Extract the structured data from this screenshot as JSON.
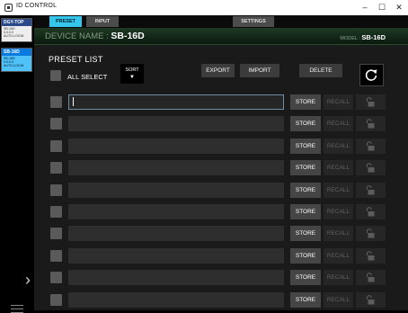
{
  "window": {
    "title": "ID CONTROL",
    "minimize_glyph": "–",
    "maximize_glyph": "☐",
    "close_glyph": "✕"
  },
  "sidebar": {
    "devices": [
      {
        "name": "DGY-TOP",
        "model": "SB-16D",
        "ip": "0.0.0.0",
        "mode": "AUTO-LOGIN",
        "active": false
      },
      {
        "name": "SB-16D",
        "model": "SB-16D",
        "ip": "0.0.0.0",
        "mode": "AUTO-LOGIN",
        "active": true
      }
    ],
    "expand_glyph": "›"
  },
  "tabs": [
    {
      "label": "PRESET",
      "active": true
    },
    {
      "label": "INPUT",
      "active": false
    },
    {
      "label": "SETTINGS",
      "active": false
    }
  ],
  "header": {
    "device_label": "DEVICE NAME : ",
    "device_name": "SB-16D",
    "model_label": "MODEL : ",
    "model_name": "SB-16D"
  },
  "preset_list": {
    "title": "PRESET LIST",
    "all_select_label": "ALL SELECT",
    "sort_label": "SORT",
    "sort_arrow": "▼",
    "export_label": "EXPORT",
    "import_label": "IMPORT",
    "delete_label": "DELETE",
    "store_label": "STORE",
    "recall_label": "RECALL",
    "rows": [
      {
        "name": "",
        "focused": true
      },
      {
        "name": "",
        "focused": false
      },
      {
        "name": "",
        "focused": false
      },
      {
        "name": "",
        "focused": false
      },
      {
        "name": "",
        "focused": false
      },
      {
        "name": "",
        "focused": false
      },
      {
        "name": "",
        "focused": false
      },
      {
        "name": "",
        "focused": false
      },
      {
        "name": "",
        "focused": false
      },
      {
        "name": "",
        "focused": false
      }
    ]
  },
  "colors": {
    "accent_tab": "#35c6ec",
    "active_device": "#4fc3f7",
    "header_green": "#1f3a24"
  },
  "icons": [
    "app-icon",
    "refresh-icon",
    "lock-icon",
    "chevron-right-icon",
    "hamburger-menu-icon"
  ]
}
